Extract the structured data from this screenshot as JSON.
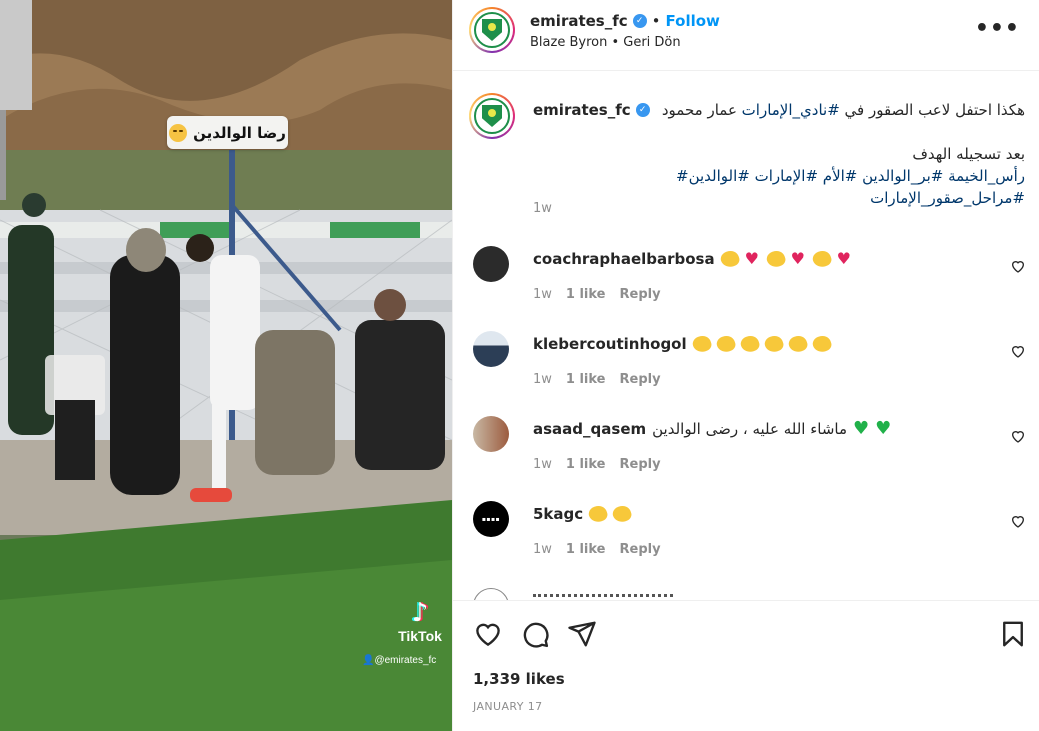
{
  "media": {
    "overlay_label": "رضا الوالدين",
    "tiktok_name": "TikTok",
    "tiktok_handle": "@emirates_fc"
  },
  "header": {
    "username": "emirates_fc",
    "follow_label": "Follow",
    "separator": "•",
    "subtitle": "Blaze Byron • Geri Dön",
    "more_label": "•••"
  },
  "caption": {
    "username": "emirates_fc",
    "text_line1_plain": "هكذا احتفل لاعب الصقور في ",
    "hashtag1": "#نادي_الإمارات",
    "text_line1_rest": " عمار محمود",
    "text_line2": "بعد تسجيله الهدف",
    "hashtags_line3": "رأس_الخيمة #بر_الوالدين #الأم #الإمارات #الوالدين#",
    "hashtags_line4": "#مراحل_صقور_الإمارات",
    "time": "1w"
  },
  "comments": [
    {
      "username": "coachraphaelbarbosa",
      "text": "",
      "time": "1w",
      "likes": "1 like",
      "reply": "Reply",
      "emojis": [
        "clap",
        "heart",
        "clap",
        "heart",
        "clap",
        "heart"
      ]
    },
    {
      "username": "klebercoutinhogol",
      "text": "",
      "time": "1w",
      "likes": "1 like",
      "reply": "Reply",
      "emojis": [
        "clap",
        "clap",
        "clap",
        "clap",
        "clap",
        "clap"
      ]
    },
    {
      "username": "asaad_qasem",
      "text": "ماشاء الله عليه ، رضى الوالدين",
      "time": "1w",
      "likes": "1 like",
      "reply": "Reply",
      "emojis": [
        "green-heart",
        "green-heart"
      ]
    },
    {
      "username": "5kagc",
      "text": "",
      "time": "1w",
      "likes": "1 like",
      "reply": "Reply",
      "emojis": [
        "clap",
        "clap"
      ]
    }
  ],
  "footer": {
    "likes": "1,339 likes",
    "date": "JANUARY 17"
  },
  "colors": {
    "accent": "#0095f6",
    "hashtag": "#00376b",
    "muted": "#8e8e8e",
    "brand_green": "#1e8f4a"
  }
}
